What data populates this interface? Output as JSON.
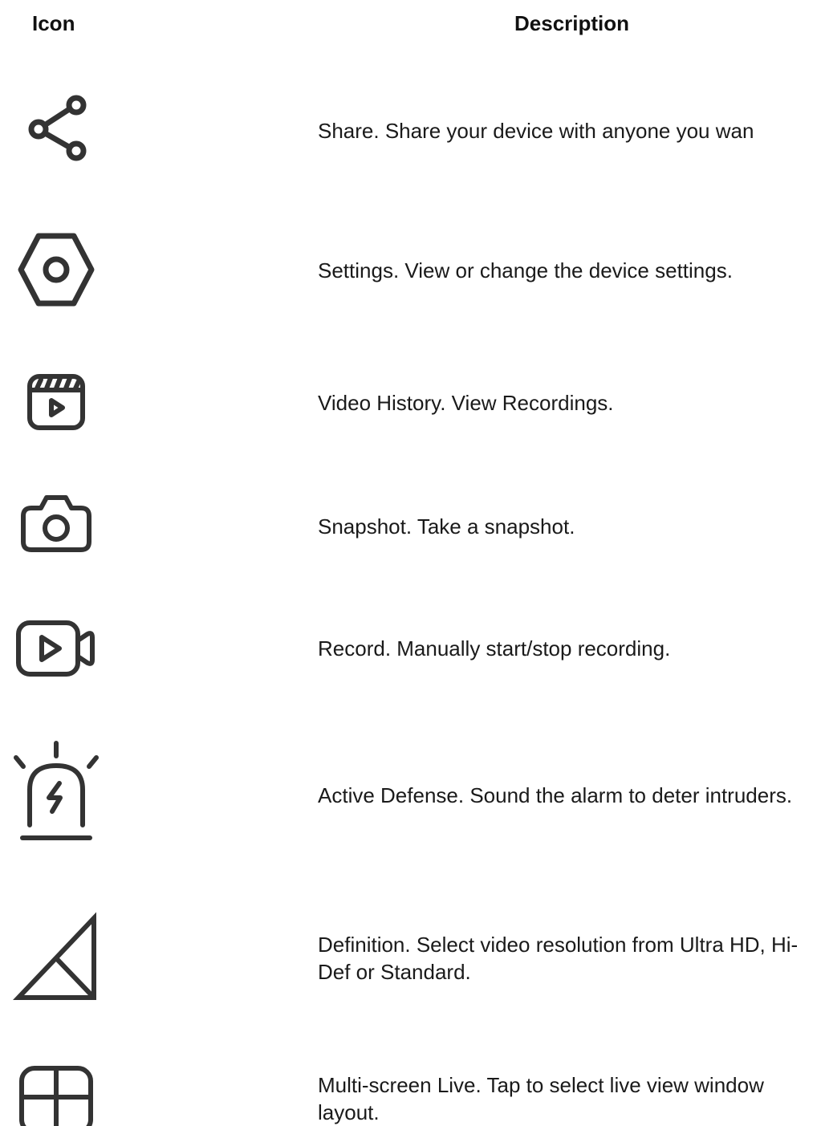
{
  "table": {
    "header_icon": "Icon",
    "header_description": "Description",
    "rows": [
      {
        "icon": "share-icon",
        "description": "Share. Share your device with anyone you wan"
      },
      {
        "icon": "settings-icon",
        "description": "Settings. View or change the device settings."
      },
      {
        "icon": "video-history-icon",
        "description": "Video History. View Recordings."
      },
      {
        "icon": "snapshot-icon",
        "description": "Snapshot. Take a snapshot."
      },
      {
        "icon": "record-icon",
        "description": "Record. Manually start/stop recording."
      },
      {
        "icon": "alarm-siren-icon",
        "description": "Active Defense. Sound the alarm to deter intruders."
      },
      {
        "icon": "signal-definition-icon",
        "description": "Definition. Select video resolution from Ultra HD, Hi-Def or Standard."
      },
      {
        "icon": "multi-screen-grid-icon",
        "description": "Multi-screen Live. Tap to select live view window layout."
      }
    ]
  },
  "colors": {
    "icon_stroke": "#333333",
    "text": "#1a1a1a"
  }
}
